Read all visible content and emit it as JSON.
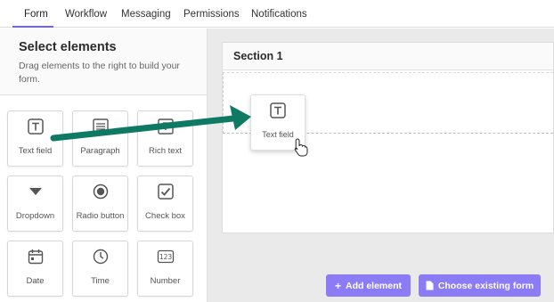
{
  "tabs": [
    {
      "label": "Form"
    },
    {
      "label": "Workflow"
    },
    {
      "label": "Messaging"
    },
    {
      "label": "Permissions"
    },
    {
      "label": "Notifications"
    }
  ],
  "sidebar": {
    "title": "Select elements",
    "subtitle": "Drag elements to the right to build your form.",
    "elements": [
      {
        "label": "Text field",
        "icon": "text-field-icon"
      },
      {
        "label": "Paragraph",
        "icon": "paragraph-icon"
      },
      {
        "label": "Rich text",
        "icon": "rich-text-icon"
      },
      {
        "label": "Dropdown",
        "icon": "dropdown-icon"
      },
      {
        "label": "Radio button",
        "icon": "radio-button-icon"
      },
      {
        "label": "Check box",
        "icon": "checkbox-icon"
      },
      {
        "label": "Date",
        "icon": "calendar-icon"
      },
      {
        "label": "Time",
        "icon": "clock-icon"
      },
      {
        "label": "Number",
        "icon": "number-icon"
      }
    ]
  },
  "canvas": {
    "section_title": "Section 1",
    "dragged_element": {
      "label": "Text field",
      "icon": "text-field-icon"
    },
    "add_element_label": "Add element",
    "choose_form_label": "Choose existing form"
  },
  "colors": {
    "accent": "#6c63ff",
    "button": "#8b7cf6",
    "arrow": "#0f7a63"
  }
}
